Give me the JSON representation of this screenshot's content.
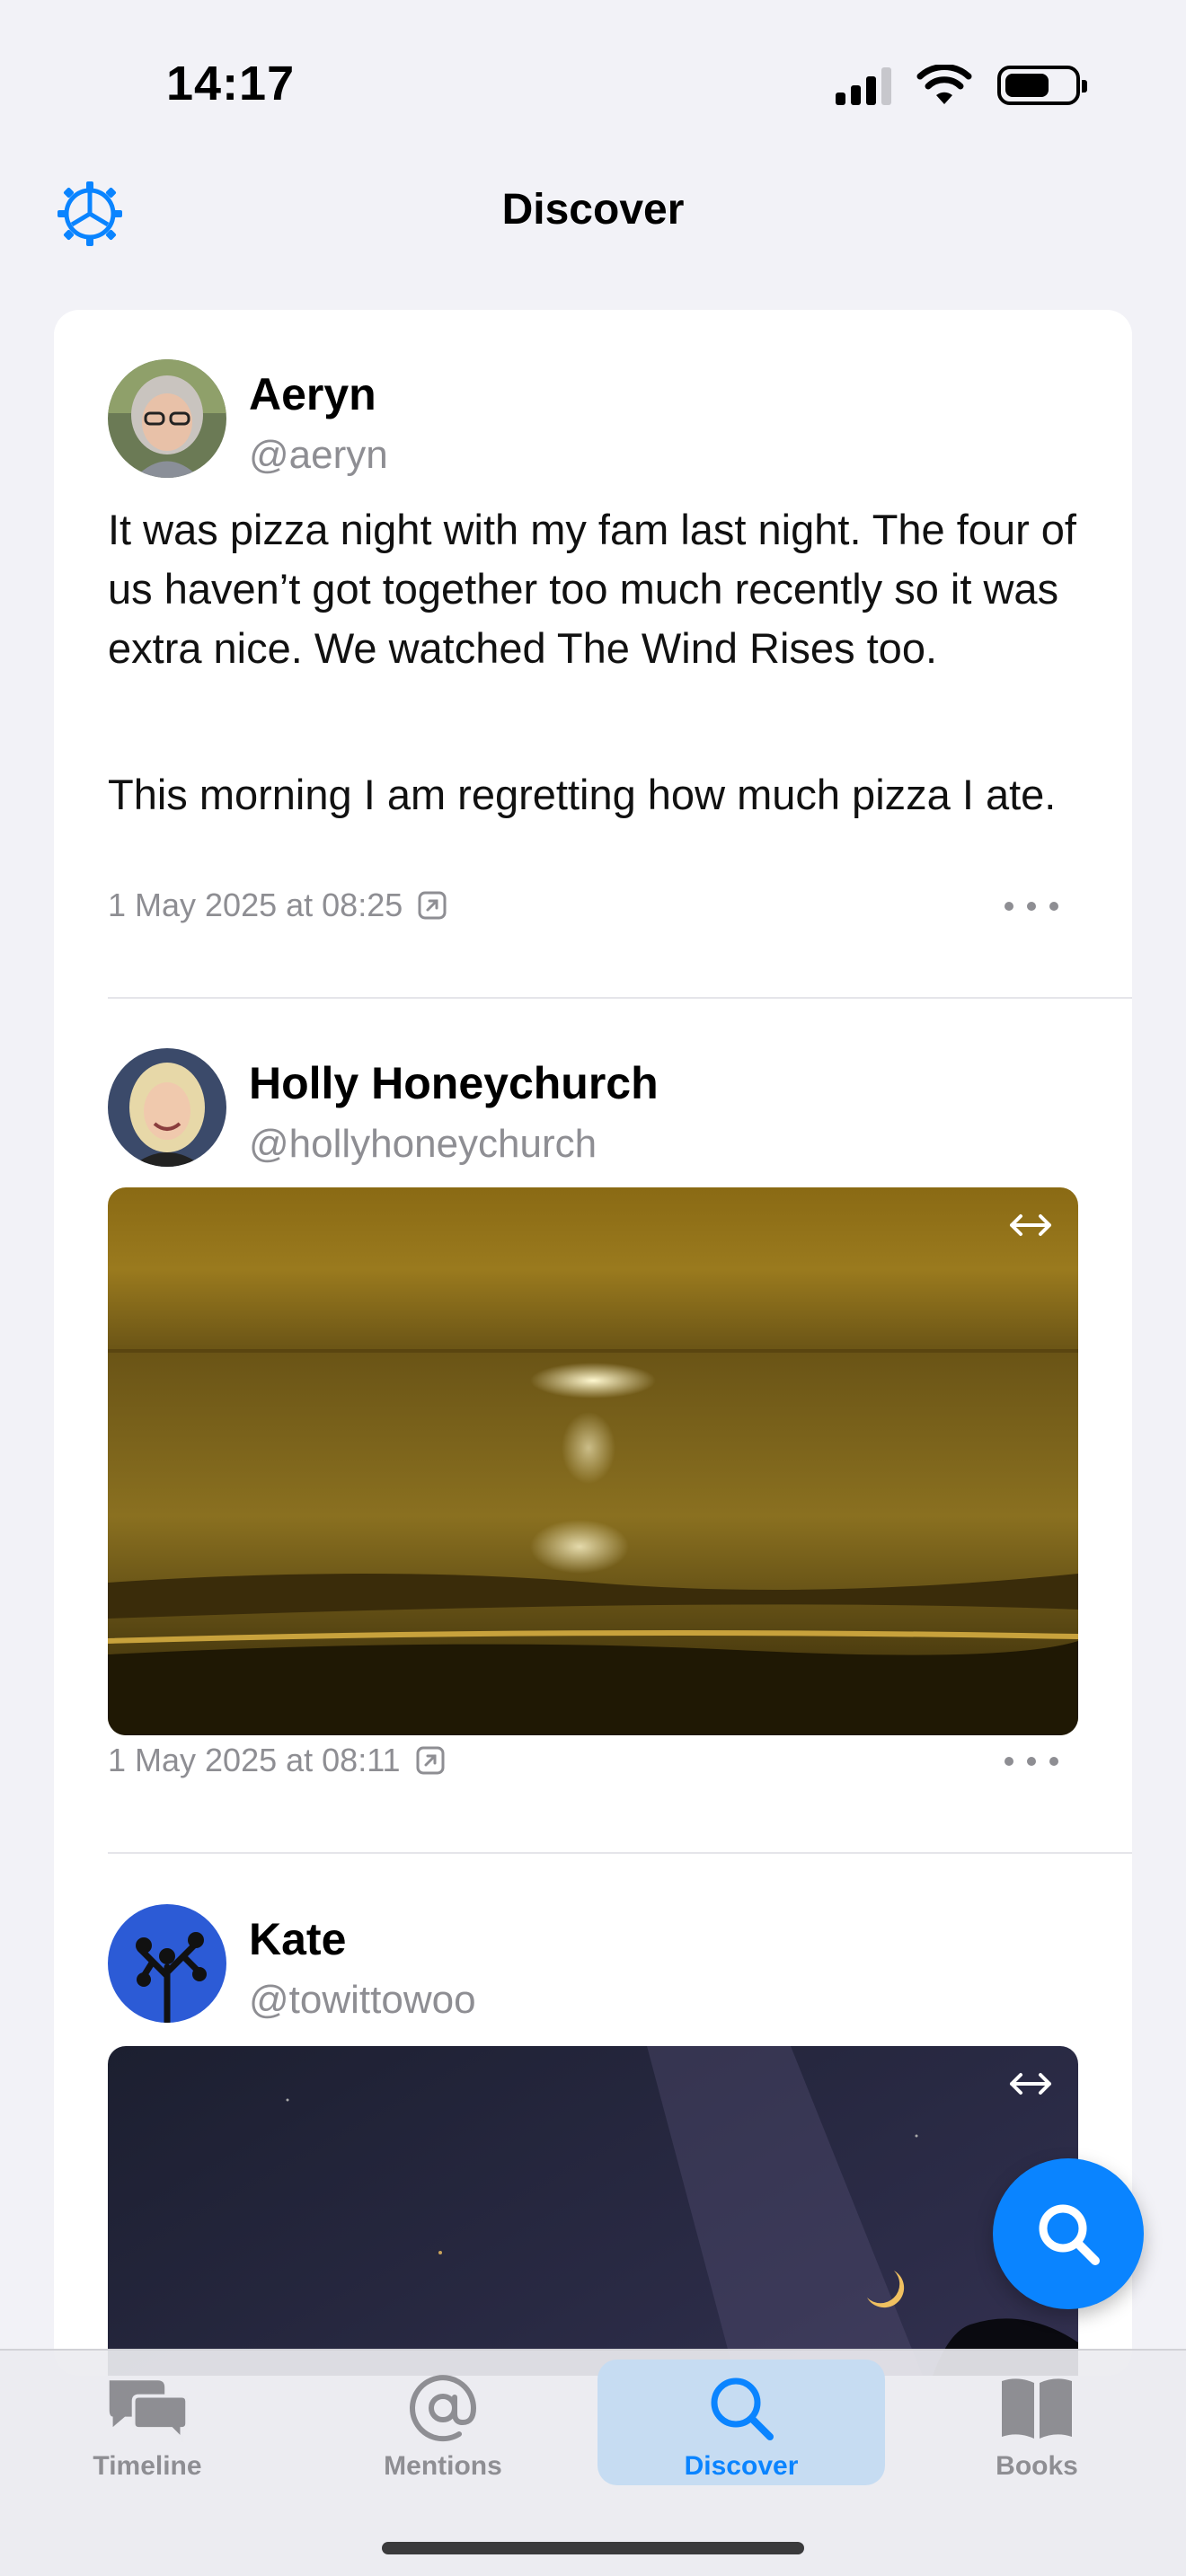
{
  "status_bar": {
    "time": "14:17"
  },
  "nav": {
    "title": "Discover"
  },
  "posts": [
    {
      "name": "Aeryn",
      "handle": "@aeryn",
      "paragraphs": [
        "It was pizza night with my fam last night. The four of us haven’t got together too much recently so it was extra nice. We watched The Wind Rises too.",
        "This morning I am regretting how much pizza I ate."
      ],
      "date": "1 May 2025 at 08:25"
    },
    {
      "name": "Holly Honeychurch",
      "handle": "@hollyhoneychurch",
      "photo": "sunset-over-sea",
      "date": "1 May 2025 at 08:11"
    },
    {
      "name": "Kate",
      "handle": "@towittowoo",
      "photo": "night-sky-crescent-moon"
    }
  ],
  "tabs": [
    {
      "label": "Timeline",
      "icon": "speech-bubbles-icon",
      "active": false
    },
    {
      "label": "Mentions",
      "icon": "at-sign-icon",
      "active": false
    },
    {
      "label": "Discover",
      "icon": "search-icon",
      "active": true
    },
    {
      "label": "Books",
      "icon": "book-icon",
      "active": false
    }
  ],
  "colors": {
    "accent": "#0a84ff",
    "background": "#f2f2f7",
    "secondary_text": "#8e8e93"
  }
}
